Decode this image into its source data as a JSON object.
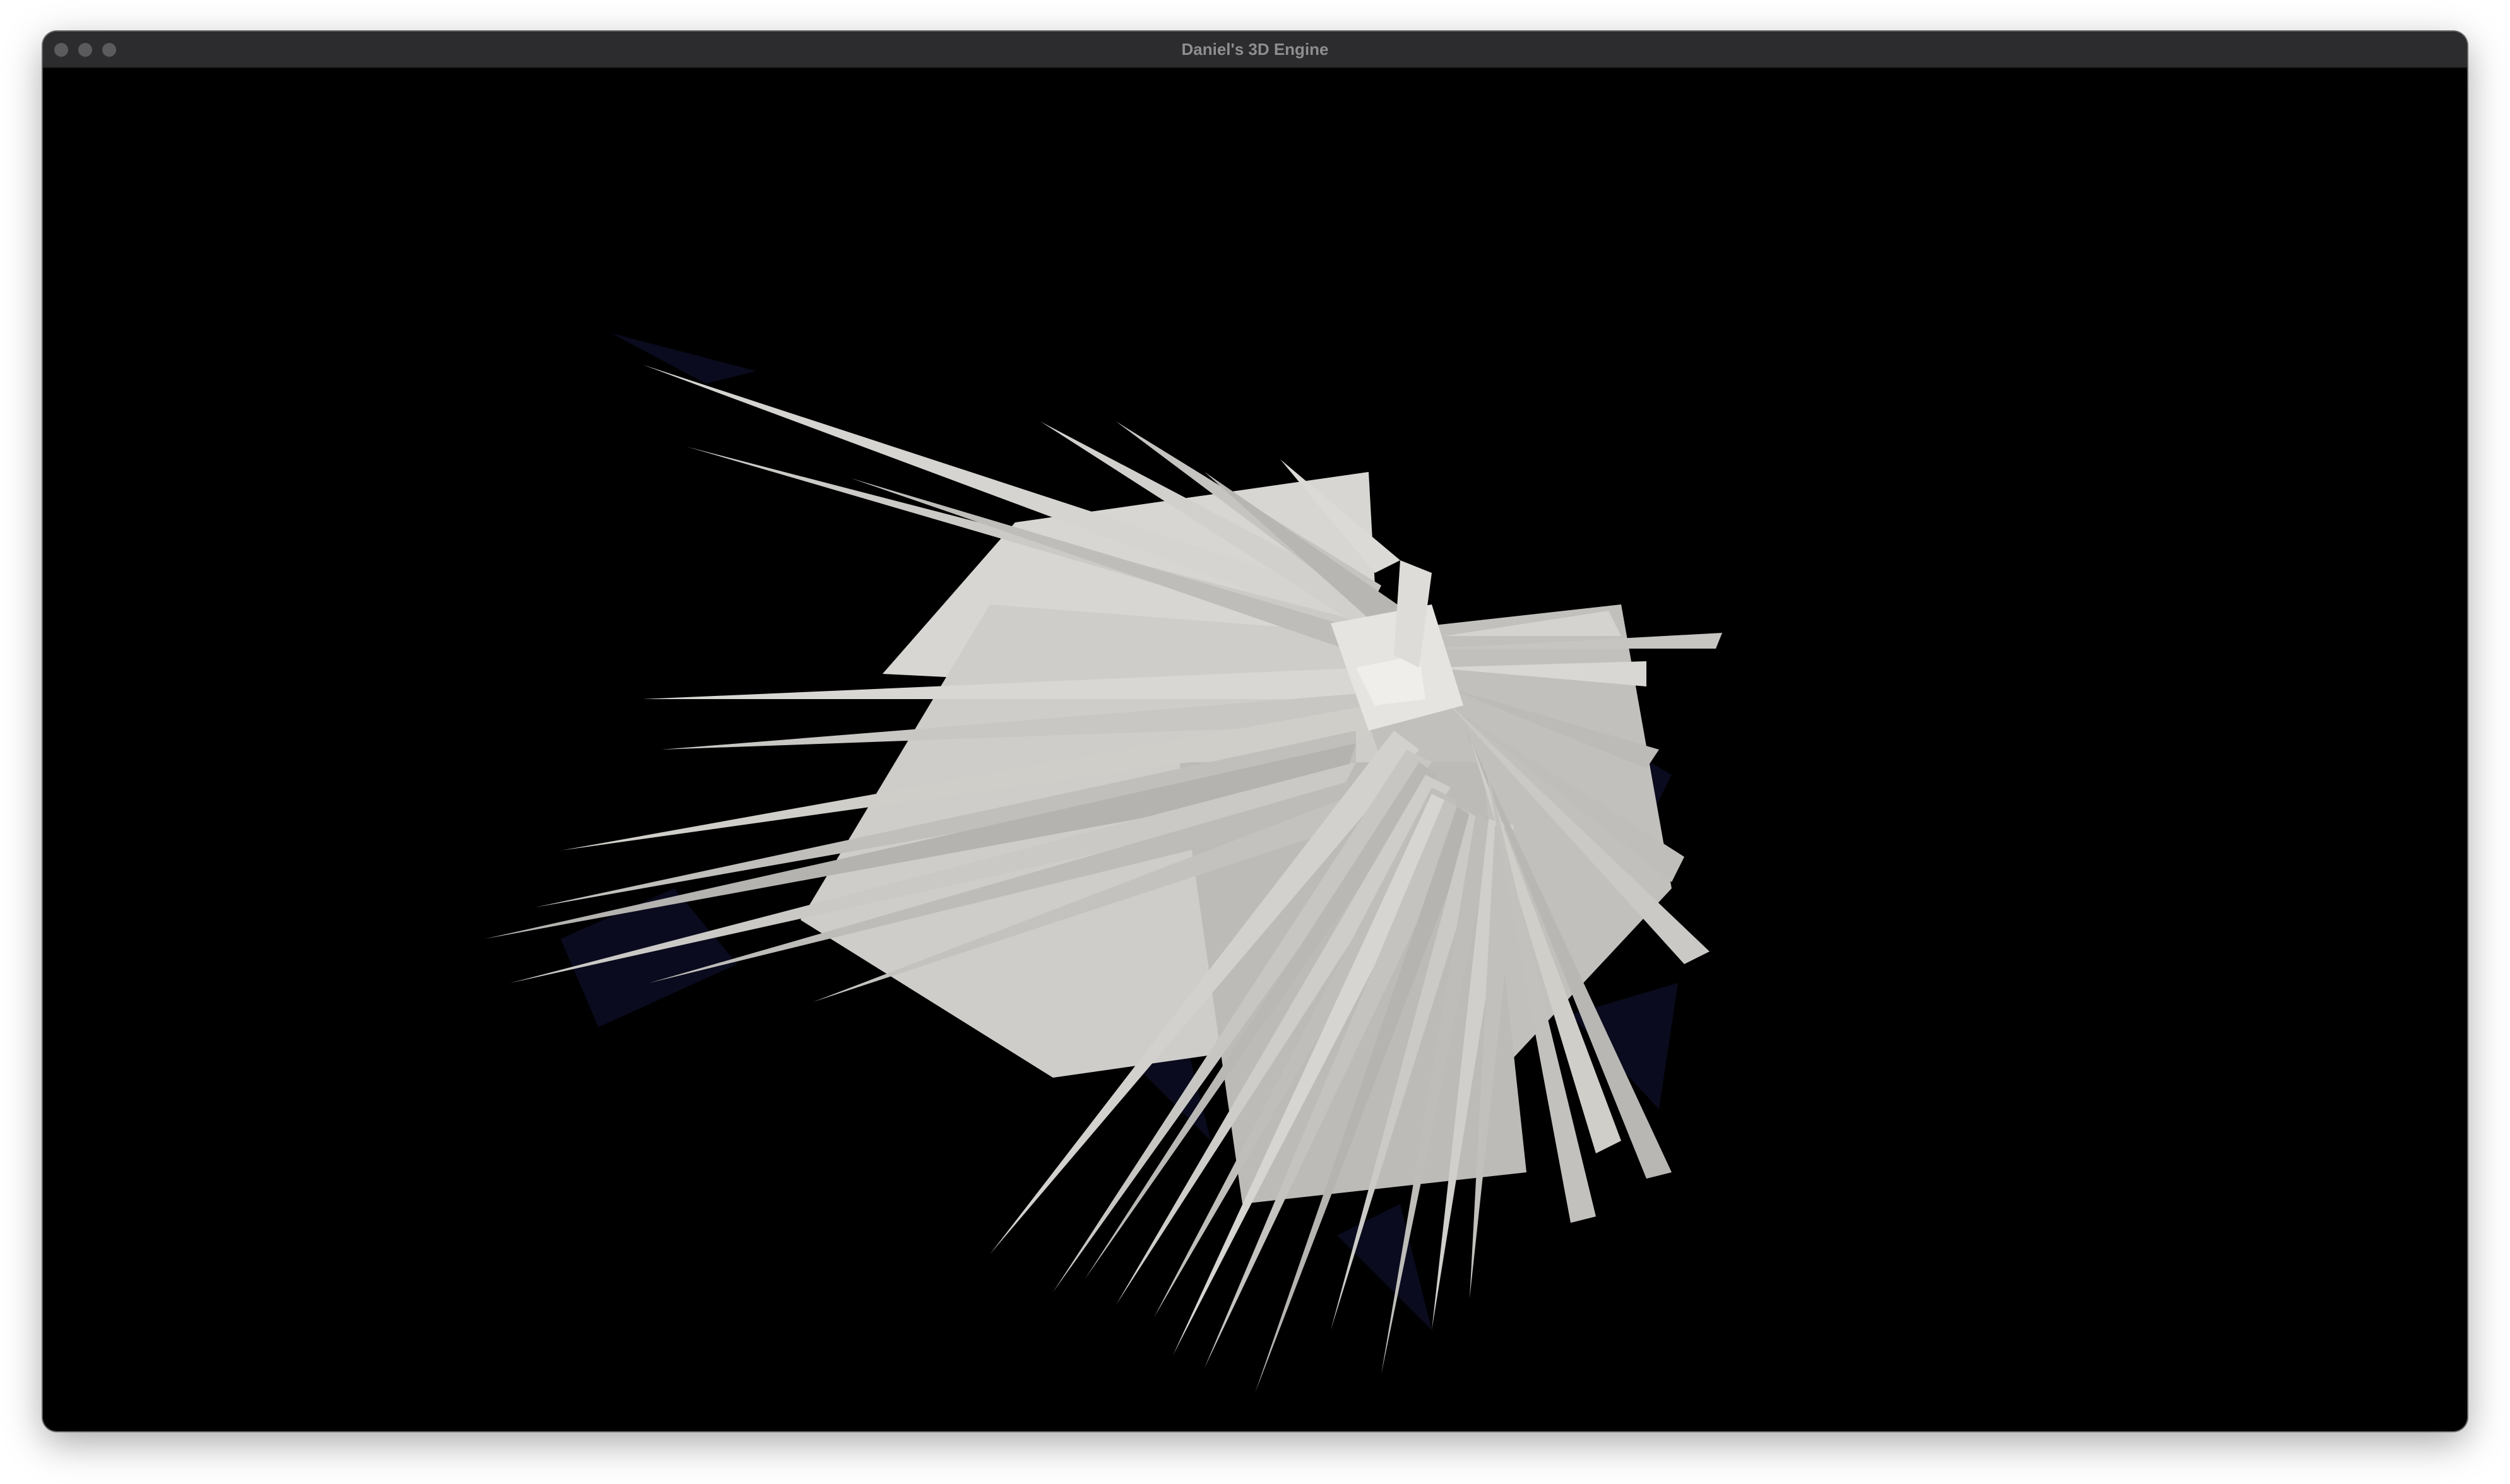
{
  "window": {
    "title": "Daniel's 3D Engine",
    "controls": [
      "close-button",
      "minimize-button",
      "zoom-button"
    ]
  },
  "viewport": {
    "background_color": "#000000",
    "mesh_color": "#c9c7c4",
    "shadow_color": "#0a0b1e"
  }
}
